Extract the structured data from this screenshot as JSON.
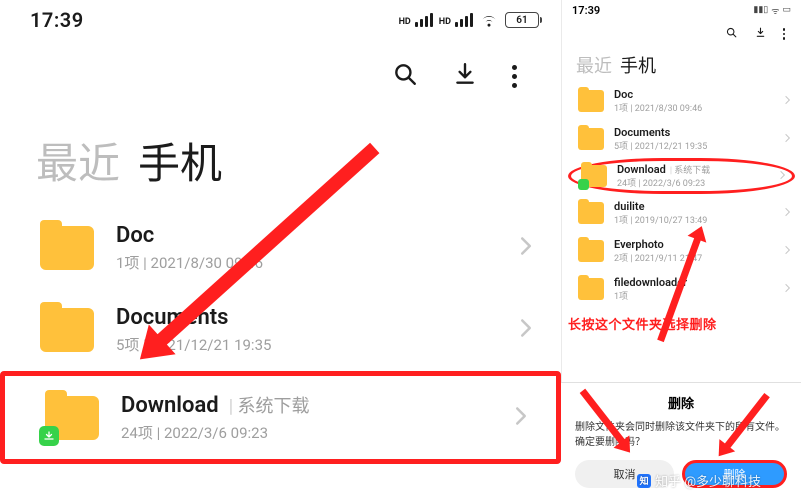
{
  "left": {
    "statusbar": {
      "time": "17:39",
      "hd1": "HD",
      "hd2": "HD",
      "battery": "61"
    },
    "tabs": {
      "recent": "最近",
      "phone": "手机"
    },
    "folders": [
      {
        "name": "Doc",
        "tag": "",
        "meta": "1项  |  2021/8/30 09:46",
        "badge": false
      },
      {
        "name": "Documents",
        "tag": "",
        "meta": "5项  |  2021/12/21 19:35",
        "badge": false
      },
      {
        "name": "Download",
        "tag": "系统下载",
        "meta": "24项  |  2022/3/6 09:23",
        "badge": true
      }
    ]
  },
  "right": {
    "statusbar": {
      "time": "17:39"
    },
    "tabs": {
      "recent": "最近",
      "phone": "手机"
    },
    "folders": [
      {
        "name": "Doc",
        "tag": "",
        "meta": "1项  |  2021/8/30 09:46",
        "badge": false
      },
      {
        "name": "Documents",
        "tag": "",
        "meta": "5项  |  2021/12/21 19:35",
        "badge": false
      },
      {
        "name": "Download",
        "tag": "系统下载",
        "meta": "24项  |  2022/3/6 09:23",
        "badge": true
      },
      {
        "name": "duilite",
        "tag": "",
        "meta": "1项  |  2019/10/27 13:49",
        "badge": false
      },
      {
        "name": "Everphoto",
        "tag": "",
        "meta": "2项  |  2021/9/11 21:47",
        "badge": false
      },
      {
        "name": "filedownloader",
        "tag": "",
        "meta": "1项",
        "badge": false
      }
    ],
    "annotation": "长按这个文件夹选择删除",
    "dialog": {
      "title": "删除",
      "body1": "删除文件夹会同时删除该文件夹下的所有文件。",
      "body2": "确定要删除吗？",
      "cancel": "取消",
      "ok": "删除"
    }
  },
  "watermark": "知乎 @多少聊科技"
}
